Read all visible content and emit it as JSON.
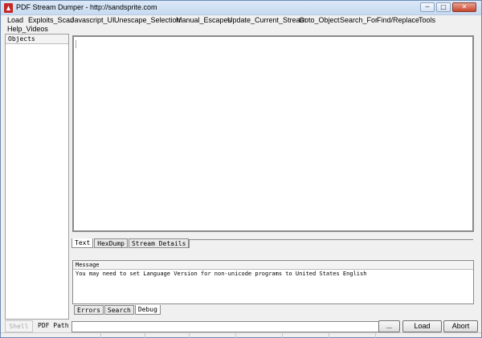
{
  "window": {
    "title": "PDF Stream Dumper - http://sandsprite.com",
    "minimize_glyph": "─",
    "maximize_glyph": "□",
    "close_glyph": "✕",
    "icon": "pdf-app-icon"
  },
  "menu": {
    "items": [
      "Load",
      "Exploits_Scan",
      "Javascript_UI",
      "Unescape_Selection",
      "Manual_Escapes",
      "Update_Current_Stream",
      "Goto_Object",
      "Search_For",
      "Find/Replace",
      "Tools",
      "Help_Videos"
    ]
  },
  "objects_panel": {
    "header": "Objects"
  },
  "editor_tabs": [
    "Text",
    "HexDump",
    "Stream Details"
  ],
  "message_panel": {
    "header": "Message",
    "text": "You may need to set Language Version for non-unicode programs to United States English"
  },
  "message_tabs": [
    "Errors",
    "Search",
    "Debug"
  ],
  "bottom_bar": {
    "shell_label": "Shell",
    "pdf_path_label": "PDF Path",
    "pdf_path_value": "",
    "browse_label": "...",
    "load_label": "Load",
    "abort_label": "Abort"
  }
}
